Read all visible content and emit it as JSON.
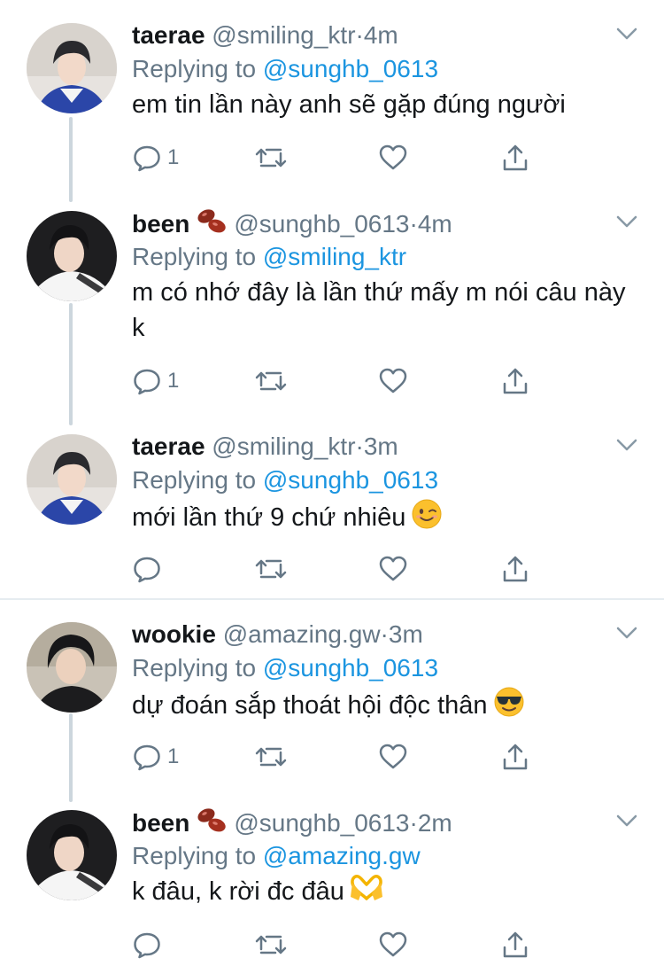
{
  "colors": {
    "link": "#1b95e0",
    "muted": "#657786",
    "text": "#14171a",
    "thread_line": "#ccd6dd"
  },
  "tweets": [
    {
      "name": "taerae",
      "handle": "@smiling_ktr",
      "dot": "·",
      "time": "4m",
      "replying_prefix": "Replying to",
      "replying_to": "@sunghb_0613",
      "text": "em tin lần này anh sẽ gặp đúng người",
      "reply_count": "1",
      "emoji": null
    },
    {
      "name": "been",
      "name_emoji": "beans-icon",
      "handle": "@sunghb_0613",
      "dot": "·",
      "time": "4m",
      "replying_prefix": "Replying to",
      "replying_to": "@smiling_ktr",
      "text": "m có nhớ đây là lần thứ mấy m nói câu này k",
      "reply_count": "1",
      "emoji": null
    },
    {
      "name": "taerae",
      "handle": "@smiling_ktr",
      "dot": "·",
      "time": "3m",
      "replying_prefix": "Replying to",
      "replying_to": "@sunghb_0613",
      "text": "mới lần thứ 9 chứ nhiêu",
      "reply_count": "",
      "emoji": "winking-face-icon"
    },
    {
      "name": "wookie",
      "handle": "@amazing.gw",
      "dot": "·",
      "time": "3m",
      "replying_prefix": "Replying to",
      "replying_to": "@sunghb_0613",
      "text": "dự đoán sắp thoát hội độc thân",
      "reply_count": "1",
      "emoji": "sunglasses-face-icon"
    },
    {
      "name": "been",
      "name_emoji": "beans-icon",
      "handle": "@sunghb_0613",
      "dot": "·",
      "time": "2m",
      "replying_prefix": "Replying to",
      "replying_to": "@amazing.gw",
      "text": "k đâu, k rời đc đâu",
      "reply_count": "",
      "emoji": "heart-hands-icon"
    }
  ]
}
